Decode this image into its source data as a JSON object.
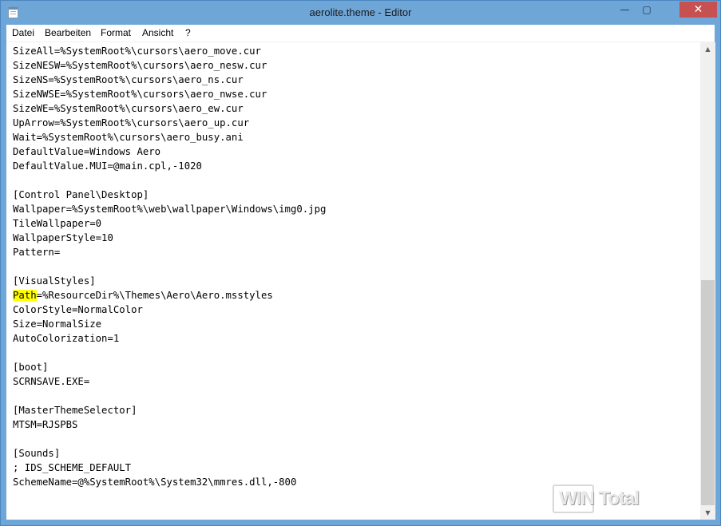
{
  "window": {
    "title": "aerolite.theme - Editor",
    "minimize_glyph": "—",
    "maximize_glyph": "▢",
    "close_glyph": "✕"
  },
  "menu": {
    "items": [
      "Datei",
      "Bearbeiten",
      "Format",
      "Ansicht",
      "?"
    ]
  },
  "editor": {
    "lines": [
      "SizeAll=%SystemRoot%\\cursors\\aero_move.cur",
      "SizeNESW=%SystemRoot%\\cursors\\aero_nesw.cur",
      "SizeNS=%SystemRoot%\\cursors\\aero_ns.cur",
      "SizeNWSE=%SystemRoot%\\cursors\\aero_nwse.cur",
      "SizeWE=%SystemRoot%\\cursors\\aero_ew.cur",
      "UpArrow=%SystemRoot%\\cursors\\aero_up.cur",
      "Wait=%SystemRoot%\\cursors\\aero_busy.ani",
      "DefaultValue=Windows Aero",
      "DefaultValue.MUI=@main.cpl,-1020",
      "",
      "[Control Panel\\Desktop]",
      "Wallpaper=%SystemRoot%\\web\\wallpaper\\Windows\\img0.jpg",
      "TileWallpaper=0",
      "WallpaperStyle=10",
      "Pattern=",
      "",
      "[VisualStyles]"
    ],
    "highlighted_word": "Path",
    "highlighted_rest": "=%ResourceDir%\\Themes\\Aero\\Aero.msstyles",
    "lines_after": [
      "ColorStyle=NormalColor",
      "Size=NormalSize",
      "AutoColorization=1",
      "",
      "[boot]",
      "SCRNSAVE.EXE=",
      "",
      "[MasterThemeSelector]",
      "MTSM=RJSPBS",
      "",
      "[Sounds]",
      "; IDS_SCHEME_DEFAULT",
      "SchemeName=@%SystemRoot%\\System32\\mmres.dll,-800"
    ],
    "highlight_color": "#ffff00"
  },
  "scrollbar": {
    "up_glyph": "▲",
    "down_glyph": "▼",
    "position_fraction": 0.88
  },
  "watermark": {
    "text": "WIN Total"
  },
  "colors": {
    "titlebar": "#6fa6d8",
    "close_button": "#c75050"
  }
}
